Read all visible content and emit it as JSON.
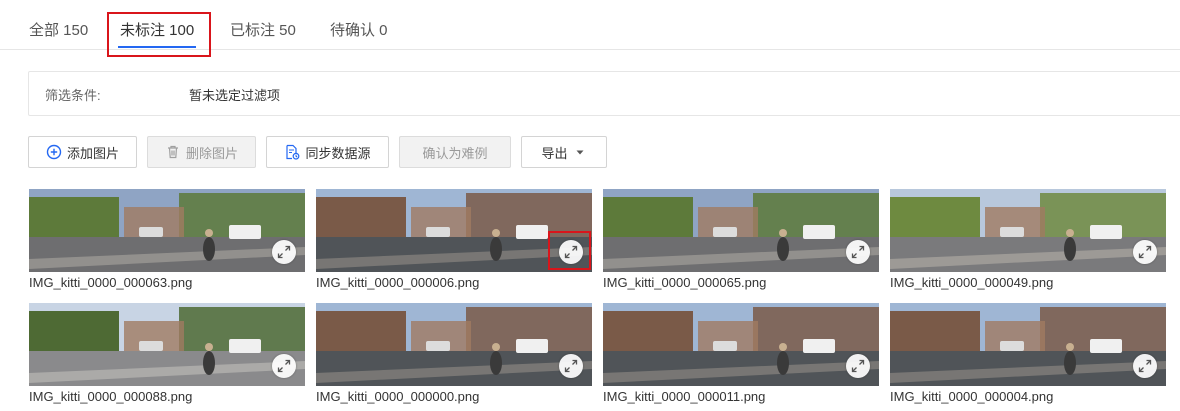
{
  "tabs": [
    {
      "label": "全部 150"
    },
    {
      "label": "未标注 100"
    },
    {
      "label": "已标注 50"
    },
    {
      "label": "待确认 0"
    }
  ],
  "active_tab_index": 1,
  "filter": {
    "label": "筛选条件:",
    "value": "暂未选定过滤项"
  },
  "toolbar": {
    "add_label": "添加图片",
    "delete_label": "删除图片",
    "sync_label": "同步数据源",
    "hard_label": "确认为难例",
    "export_label": "导出"
  },
  "colors": {
    "accent": "#2468f2",
    "highlight": "#d9151b"
  },
  "images": [
    {
      "name": "IMG_kitti_0000_000063.png"
    },
    {
      "name": "IMG_kitti_0000_000006.png"
    },
    {
      "name": "IMG_kitti_0000_000065.png"
    },
    {
      "name": "IMG_kitti_0000_000049.png"
    },
    {
      "name": "IMG_kitti_0000_000088.png"
    },
    {
      "name": "IMG_kitti_0000_000000.png"
    },
    {
      "name": "IMG_kitti_0000_000011.png"
    },
    {
      "name": "IMG_kitti_0000_000004.png"
    }
  ]
}
